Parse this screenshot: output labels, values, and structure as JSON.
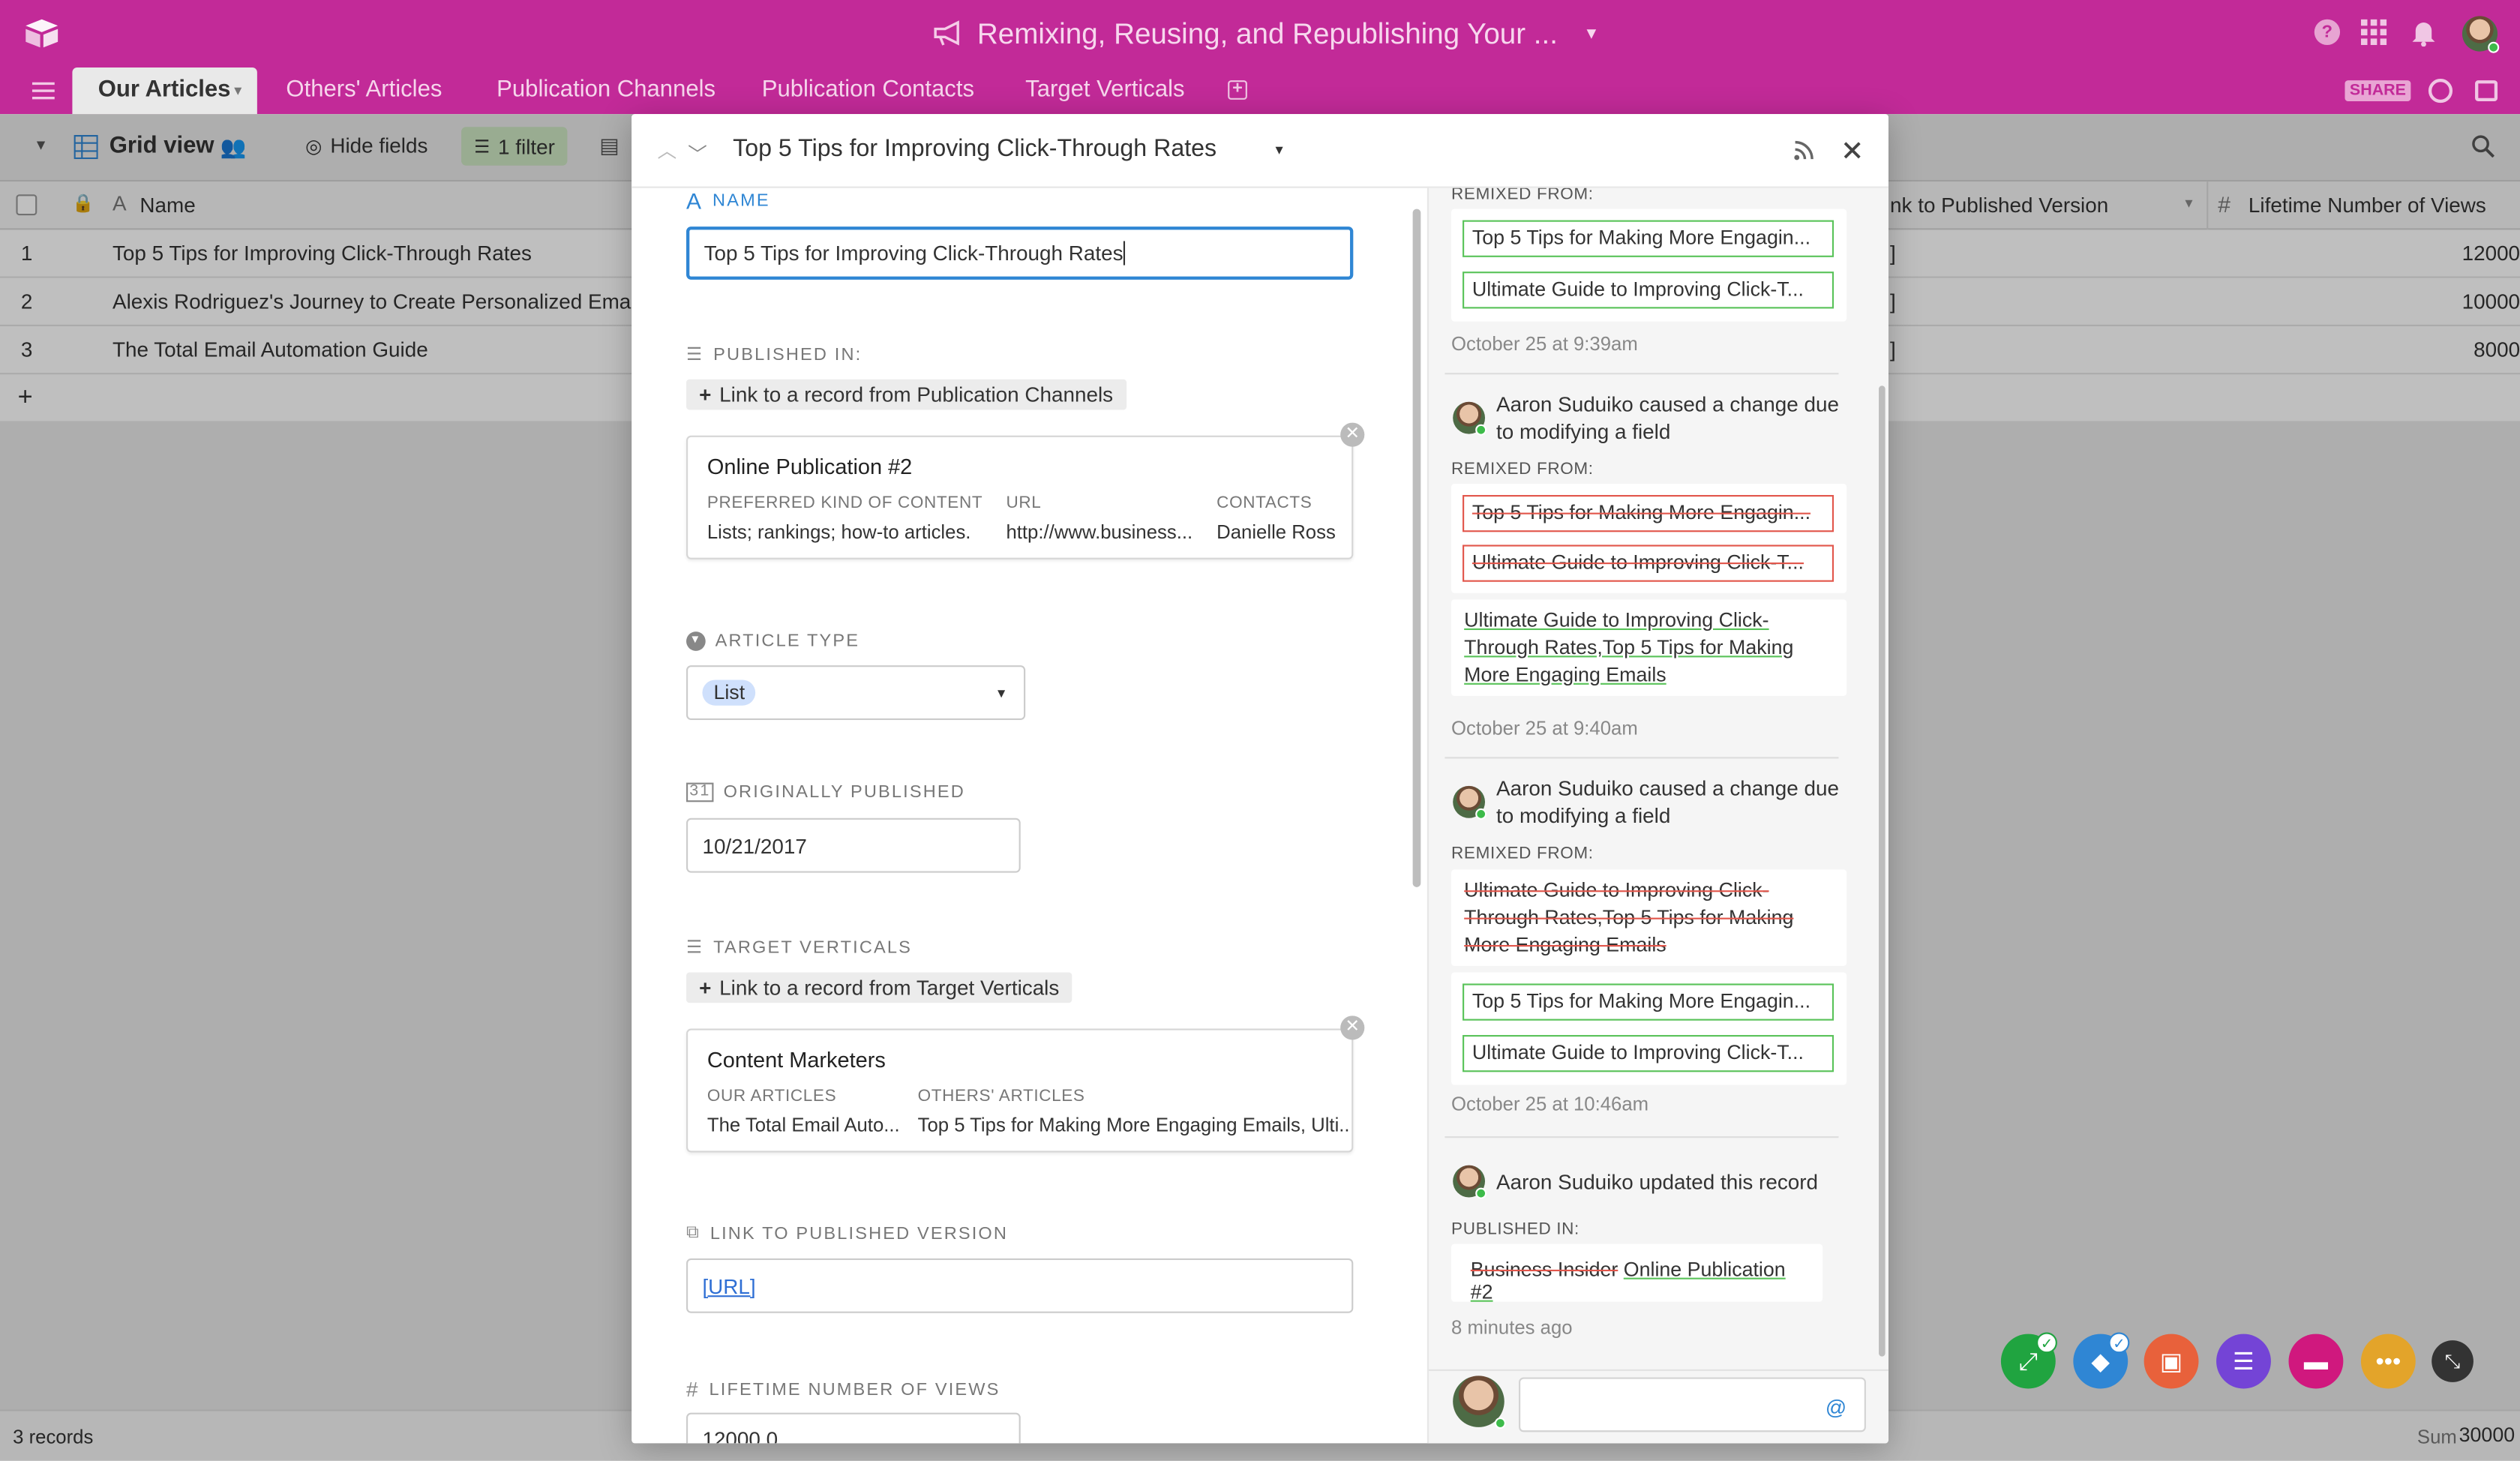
{
  "app": {
    "title": "Remixing, Reusing, and Republishing Your ...",
    "share_label": "SHARE"
  },
  "tabs": [
    {
      "label": "Our Articles",
      "active": true
    },
    {
      "label": "Others' Articles"
    },
    {
      "label": "Publication Channels"
    },
    {
      "label": "Publication Contacts"
    },
    {
      "label": "Target Verticals"
    }
  ],
  "viewbar": {
    "view_name": "Grid view",
    "hide_fields": "Hide fields",
    "filter": "1 filter"
  },
  "grid": {
    "columns": [
      "Name",
      "nk to Published Version",
      "Lifetime Number of Views"
    ],
    "rows": [
      {
        "num": "1",
        "name": "Top 5 Tips for Improving Click-Through Rates",
        "link": "]",
        "views": "12000"
      },
      {
        "num": "2",
        "name": "Alexis Rodriguez's Journey to Create Personalized Email",
        "link": "]",
        "views": "10000"
      },
      {
        "num": "3",
        "name": "The Total Email Automation Guide",
        "link": "]",
        "views": "8000"
      }
    ],
    "add_row": "+",
    "record_count": "3 records",
    "sum_label": "Sum",
    "sum_value": "30000"
  },
  "record": {
    "title": "Top 5 Tips for Improving Click-Through Rates",
    "name_label": "NAME",
    "name_value": "Top 5 Tips for Improving Click-Through Rates",
    "published_in_label": "PUBLISHED IN:",
    "published_in_link": "Link to a record from Publication Channels",
    "publication_card": {
      "title": "Online Publication #2",
      "fields": [
        {
          "label": "PREFERRED KIND OF CONTENT",
          "value": "Lists; rankings; how-to articles."
        },
        {
          "label": "URL",
          "value": "http://www.business..."
        },
        {
          "label": "CONTACTS",
          "value": "Danielle Ross"
        }
      ]
    },
    "article_type_label": "ARTICLE TYPE",
    "article_type_value": "List",
    "originally_published_label": "ORIGINALLY PUBLISHED",
    "originally_published_value": "10/21/2017",
    "target_verticals_label": "TARGET VERTICALS",
    "target_verticals_link": "Link to a record from Target Verticals",
    "vertical_card": {
      "title": "Content Marketers",
      "fields": [
        {
          "label": "OUR ARTICLES",
          "value": "The Total Email Auto..."
        },
        {
          "label": "OTHERS' ARTICLES",
          "value": "Top 5 Tips for Making More Engaging Emails, Ulti..."
        }
      ]
    },
    "link_published_label": "LINK TO PUBLISHED VERSION",
    "link_published_value": "[URL]",
    "lifetime_views_label": "LIFETIME NUMBER OF VIEWS",
    "lifetime_views_value": "12000.0"
  },
  "activity": {
    "entry0": {
      "label": "REMIXED FROM:",
      "added": [
        "Top 5 Tips for Making More Engagin...",
        "Ultimate Guide to Improving Click-T..."
      ],
      "time": "October 25 at 9:39am"
    },
    "entry1": {
      "actor": "Aaron Suduiko caused a change due to modifying a field",
      "label": "REMIXED FROM:",
      "removed": [
        "Top 5 Tips for Making More Engagin...",
        "Ultimate Guide to Improving Click-T..."
      ],
      "added_text": "Ultimate Guide to Improving Click-Through Rates,Top 5 Tips for Making More Engaging Emails",
      "time": "October 25 at 9:40am"
    },
    "entry2": {
      "actor": "Aaron Suduiko caused a change due to modifying a field",
      "label": "REMIXED FROM:",
      "removed_text": "Ultimate Guide to Improving Click-Through Rates,Top 5 Tips for Making More Engaging Emails",
      "added": [
        "Top 5 Tips for Making More Engagin...",
        "Ultimate Guide to Improving Click-T..."
      ],
      "time": "October 25 at 10:46am"
    },
    "entry3": {
      "actor": "Aaron Suduiko updated this record",
      "label": "PUBLISHED IN:",
      "removed_text": "Business Insider",
      "added_text": "Online Publication #2",
      "time": "8 minutes ago"
    },
    "comment_at": "@"
  },
  "colors": {
    "brand": "#c22a98",
    "added": "#5ac35a",
    "removed": "#e2574c"
  }
}
